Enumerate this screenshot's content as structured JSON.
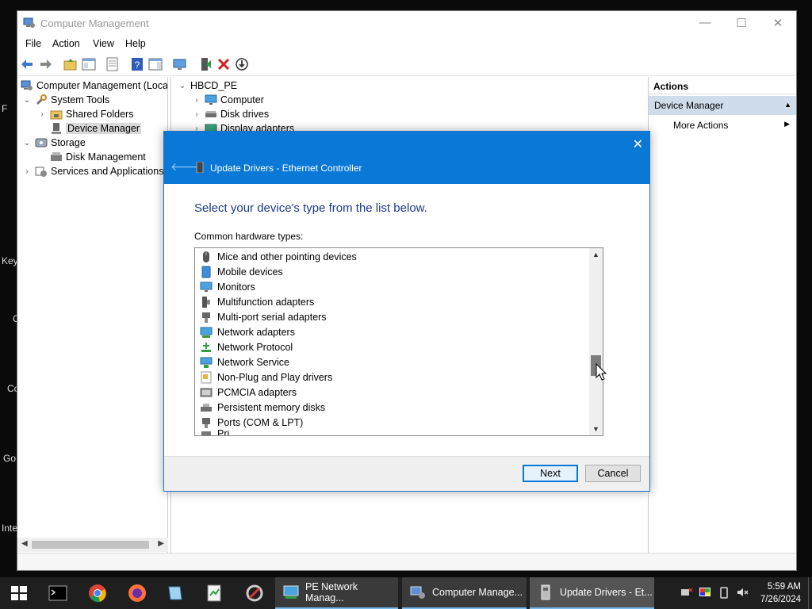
{
  "desktop": {
    "left_fragments": [
      "F",
      "Key",
      "C",
      "Co",
      "Go",
      "Inte"
    ]
  },
  "window": {
    "title": "Computer Management",
    "menu": [
      "File",
      "Action",
      "View",
      "Help"
    ],
    "tree": [
      {
        "label": "Computer Management (Local",
        "icon": "computer-management-icon",
        "level": 0
      },
      {
        "label": "System Tools",
        "icon": "tools-icon",
        "level": 1,
        "expanded": true
      },
      {
        "label": "Shared Folders",
        "icon": "shared-folder-icon",
        "level": 2
      },
      {
        "label": "Device Manager",
        "icon": "device-manager-icon",
        "level": 2,
        "selected": true
      },
      {
        "label": "Storage",
        "icon": "storage-icon",
        "level": 1,
        "expanded": true
      },
      {
        "label": "Disk Management",
        "icon": "disk-management-icon",
        "level": 2
      },
      {
        "label": "Services and Applications",
        "icon": "services-icon",
        "level": 1
      }
    ],
    "device_tree": [
      {
        "label": "HBCD_PE",
        "icon": "computer-icon"
      },
      {
        "label": "Computer",
        "icon": "monitor-icon"
      },
      {
        "label": "Disk drives",
        "icon": "disk-drive-icon"
      },
      {
        "label": "Display adapters",
        "icon": "display-adapter-icon"
      }
    ],
    "actions": {
      "header": "Actions",
      "section": "Device Manager",
      "more": "More Actions"
    }
  },
  "dialog": {
    "title": "Update Drivers - Ethernet Controller",
    "heading": "Select your device's type from the list below.",
    "list_label": "Common hardware types:",
    "items": [
      {
        "label": "Mice and other pointing devices",
        "icon": "mouse-icon"
      },
      {
        "label": "Mobile devices",
        "icon": "mobile-device-icon"
      },
      {
        "label": "Monitors",
        "icon": "monitor-icon"
      },
      {
        "label": "Multifunction adapters",
        "icon": "multifunction-adapter-icon"
      },
      {
        "label": "Multi-port serial adapters",
        "icon": "serial-adapter-icon"
      },
      {
        "label": "Network adapters",
        "icon": "network-adapter-icon"
      },
      {
        "label": "Network Protocol",
        "icon": "network-protocol-icon"
      },
      {
        "label": "Network Service",
        "icon": "network-service-icon"
      },
      {
        "label": "Non-Plug and Play drivers",
        "icon": "driver-icon"
      },
      {
        "label": "PCMCIA adapters",
        "icon": "pcmcia-icon"
      },
      {
        "label": "Persistent memory disks",
        "icon": "memory-disk-icon"
      },
      {
        "label": "Ports (COM & LPT)",
        "icon": "port-icon"
      },
      {
        "label": "Pri...",
        "icon": "printer-icon"
      }
    ],
    "buttons": {
      "next": "Next",
      "cancel": "Cancel"
    }
  },
  "taskbar": {
    "pinned": [
      "command-prompt-icon",
      "chrome-icon",
      "firefox-icon",
      "notepad-icon",
      "file-icon",
      "tool-icon"
    ],
    "tasks": [
      {
        "label": "PE Network Manag...",
        "icon": "network-manager-icon",
        "active": false
      },
      {
        "label": "Computer Manage...",
        "icon": "computer-management-icon",
        "active": false
      },
      {
        "label": "Update Drivers - Et...",
        "icon": "update-drivers-icon",
        "active": true
      }
    ],
    "time": "5:59 AM",
    "date": "7/26/2024"
  }
}
